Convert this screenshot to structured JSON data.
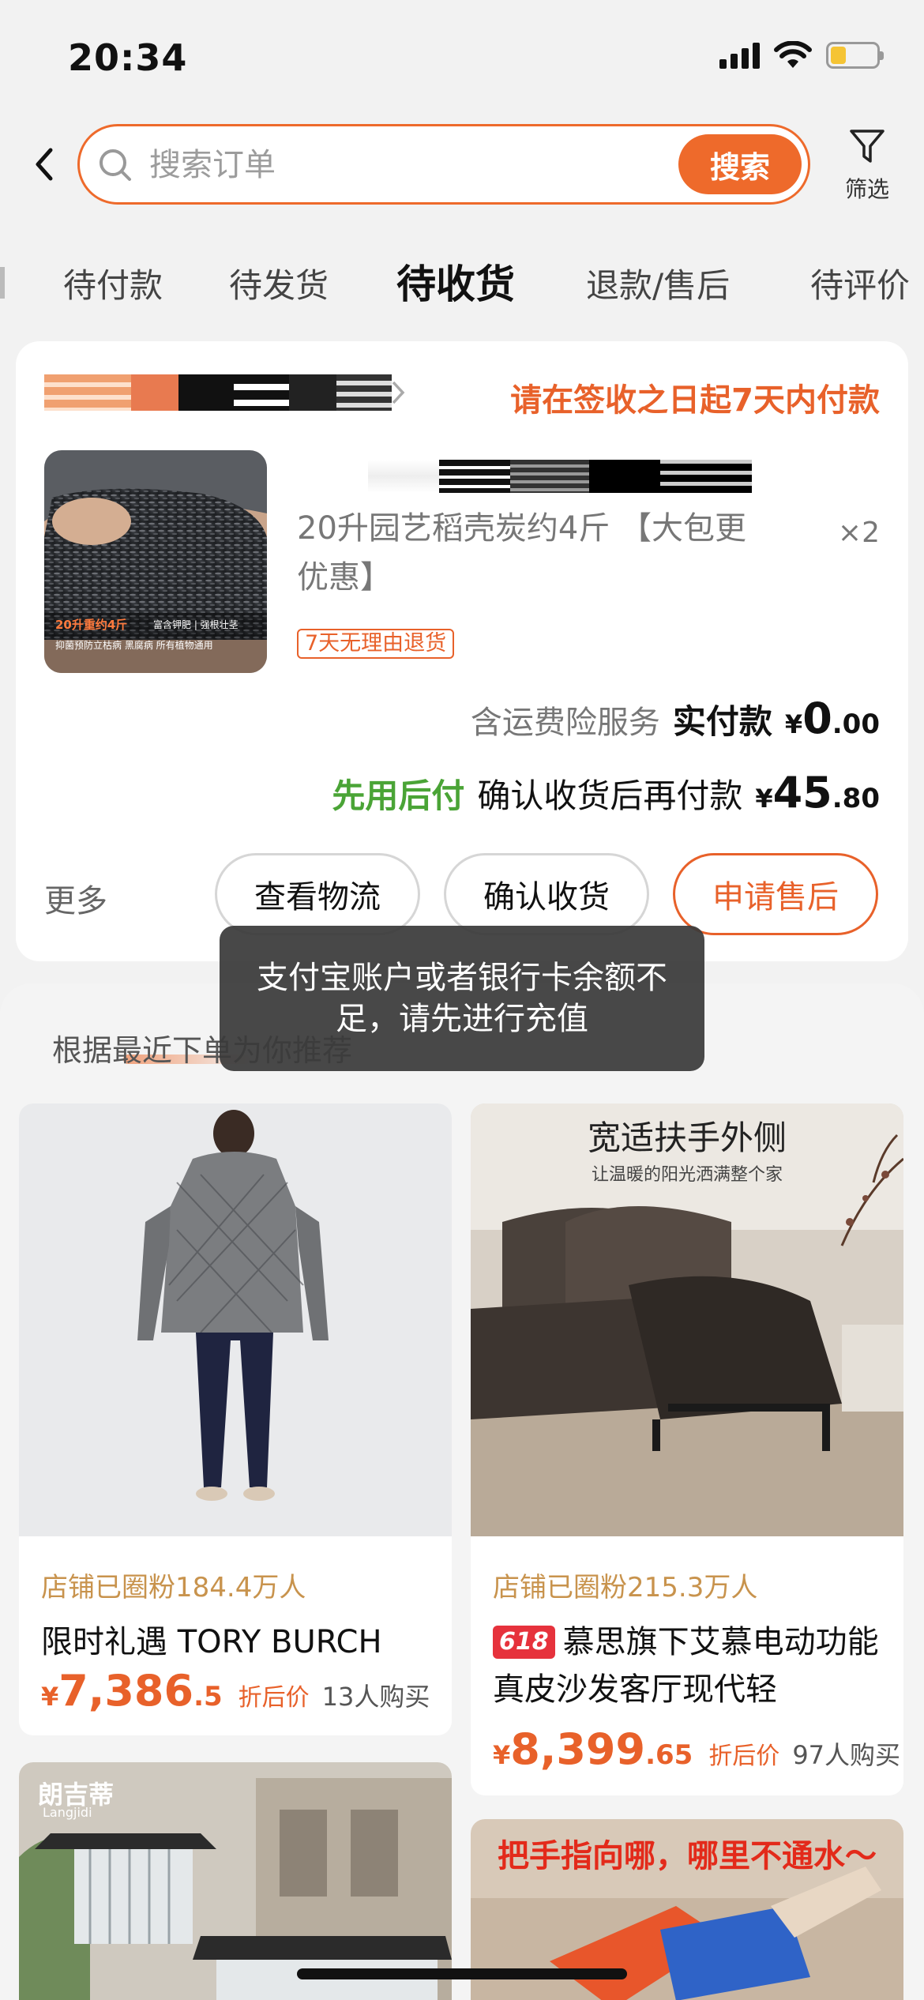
{
  "status_bar": {
    "time": "20:34"
  },
  "header": {
    "search_placeholder": "搜索订单",
    "search_button": "搜索",
    "filter_label": "筛选"
  },
  "tabs": [
    {
      "label": "待付款",
      "active": false
    },
    {
      "label": "待发货",
      "active": false
    },
    {
      "label": "待收货",
      "active": true
    },
    {
      "label": "退款/售后",
      "active": false
    },
    {
      "label": "待评价",
      "active": false
    }
  ],
  "order": {
    "payment_notice": "请在签收之日起7天内付款",
    "product_title": "20升园艺稻壳炭约4斤 【大包更优惠】",
    "quantity": "×2",
    "return_badge": "7天无理由退货",
    "insurance_text": "含运费险服务",
    "paid_label": "实付款",
    "paid_currency": "¥",
    "paid_int": "0",
    "paid_dec": ".00",
    "paylater_label": "先用后付",
    "confirm_later_text": "确认收货后再付款",
    "later_currency": "¥",
    "later_int": "45",
    "later_dec": ".80",
    "image_text_1": "20升重约4斤",
    "image_text_2": "富含钾肥 | 强根壮茎",
    "image_text_3": "抑菌预防立枯病 黑腐病  所有植物通用",
    "more_label": "更多",
    "buttons": {
      "logistics": "查看物流",
      "confirm": "确认收货",
      "aftersale": "申请售后"
    }
  },
  "toast": {
    "message": "支付宝账户或者银行卡余额不足，请先进行充值"
  },
  "recommend": {
    "title": "根据最近下单为你推荐",
    "items": [
      {
        "fans": "店铺已圈粉184.4万人",
        "name": "限时礼遇 TORY BURCH",
        "currency": "¥",
        "price_int": "7,386",
        "price_dec": ".5",
        "discount_label": "折后价",
        "buyers": "13人购买"
      },
      {
        "image_headline": "宽适扶手外侧",
        "image_sub": "让温暖的阳光洒满整个家",
        "fans": "店铺已圈粉215.3万人",
        "badge": "618",
        "name": "慕思旗下艾慕电动功能真皮沙发客厅现代轻",
        "currency": "¥",
        "price_int": "8,399",
        "price_dec": ".65",
        "discount_label": "折后价",
        "buyers": "97人购买"
      },
      {
        "image_brand": "朗吉蒂",
        "image_brand_sub": "Langjidi"
      },
      {
        "image_headline": "把手指向哪，哪里不通水～"
      }
    ]
  },
  "colors": {
    "accent": "#ee6a2b",
    "green": "#4aa436",
    "gold": "#c8934d"
  }
}
